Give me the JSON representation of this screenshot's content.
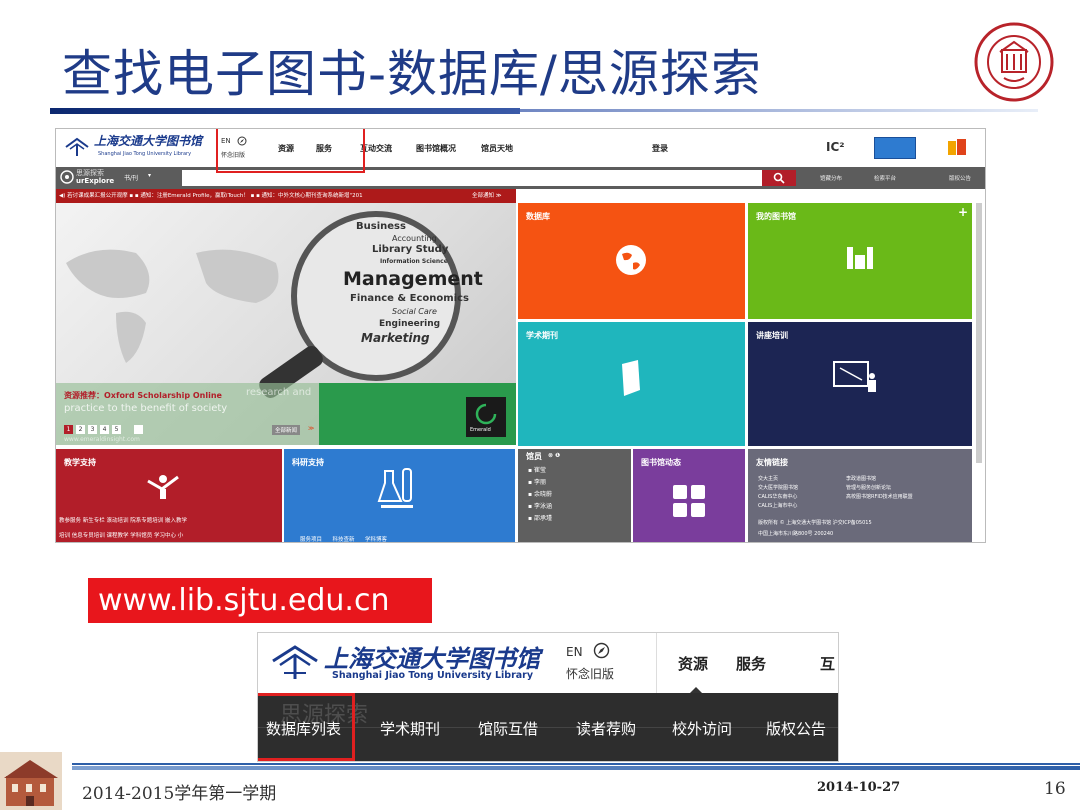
{
  "slide": {
    "title": "查找电子图书-数据库/思源探索",
    "url": "www.lib.sjtu.edu.cn",
    "footer_left": "2014-2015学年第一学期",
    "footer_date": "2014-10-27",
    "page_number": "16"
  },
  "site": {
    "logo_cn": "上海交通大学图书馆",
    "logo_en": "Shanghai Jiao Tong University Library",
    "lang_en": "EN",
    "old_version": "怀念旧版",
    "nav": [
      "资源",
      "服务",
      "互动交流",
      "图书馆概况",
      "馆员天地"
    ],
    "login": "登录",
    "ic_label": "IC²",
    "search_brand_cn": "思源探索",
    "search_brand_en": "urExplore",
    "search_scope": "书/刊",
    "search_links": [
      "馆藏分布",
      "检索平台",
      "版权公告"
    ],
    "notice": "◀) 若讨课成果汇报公开观摩  ▪ ▪ 通知：注册Emerald Profile，赢取iTouch！ ▪ ▪ 通知：中外文核心期刊查询系统新增\"201",
    "notice_all": "全部通知 ≫",
    "banner_words": [
      "Business",
      "Accounting",
      "Library Study",
      "Information Science",
      "Management",
      "Finance & Economics",
      "Social Care",
      "Engineering",
      "Marketing"
    ],
    "banner_caption": "资源推荐：Oxford Scholarship Online",
    "banner_sub": "practice to the benefit of society",
    "banner_faded": "research and",
    "banner_pages": [
      "1",
      "2",
      "3",
      "4",
      "5"
    ],
    "banner_all": "全部新闻",
    "banner_site": "www.emeraldinsight.com",
    "emerald": "Emerald",
    "tiles": {
      "db": "数据库",
      "mylib": "我的图书馆",
      "journals": "学术期刊",
      "training": "讲座培训",
      "teaching": "教学支持",
      "research": "科研支持",
      "librarians": "馆员",
      "news": "图书馆动态",
      "links": "友情链接"
    },
    "teaching_links": "教参服务  新生专栏  滚动培训  院系专题培训  嵌入教学",
    "teaching_links2": "培训  信息专员培训  课程教学  学科馆员  学习中心  小",
    "research_links": "服务项目      科技查新      学科博客",
    "librarians_list": [
      "崔莹",
      "李丽",
      "余晓蔚",
      "李泳涵",
      "邵承瑾"
    ],
    "links_col1": [
      "交大主页",
      "交大医学院图书馆",
      "CALIS华东南中心",
      "CALIS上海市中心"
    ],
    "links_col2": [
      "李政道图书馆",
      "管理与服务创新论坛",
      "高校图书馆RFID技术应用联盟"
    ],
    "copyright": "版权所有 © 上海交通大学图书馆 沪交ICP备05015",
    "address": "中国上海市东川路800号 200240"
  },
  "zoom": {
    "logo_cn": "上海交通大学图书馆",
    "logo_en": "Shanghai Jiao Tong University Library",
    "lang_en": "EN",
    "old_version": "怀念旧版",
    "nav": [
      "资源",
      "服务",
      "互"
    ],
    "brand_watermark": "思源探索",
    "tabs": [
      "数据库列表",
      "学术期刊",
      "馆际互借",
      "读者荐购",
      "校外访问",
      "版权公告"
    ]
  },
  "colors": {
    "title": "#1f3b87",
    "db_tile": "#f55312",
    "mylib_tile": "#6ab918",
    "journals_tile": "#1fb6bd",
    "training_tile": "#1c2553",
    "teaching_tile": "#b21e29",
    "research_tile": "#2e7bd0",
    "librarians_tile": "#5f5f5f",
    "news_tile": "#7a3d9c",
    "links_tile": "#6a6a7a",
    "highlight": "#e02020"
  }
}
